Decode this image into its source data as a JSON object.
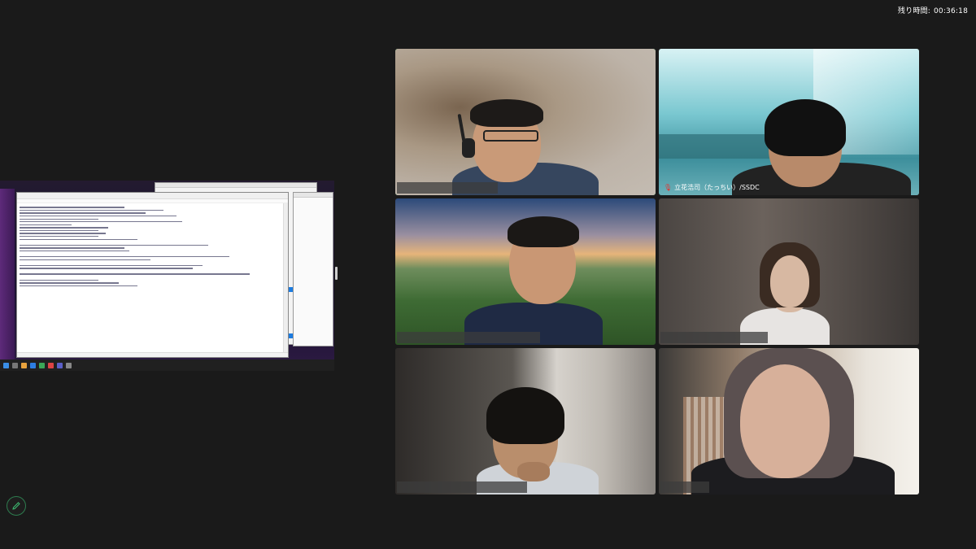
{
  "timer": {
    "label": "残り時間:",
    "value": "00:36:18"
  },
  "participants": [
    {
      "name": "",
      "active": true
    },
    {
      "name": "立花浩司（たっちい）/SSDC",
      "muted": true
    },
    {
      "name": ""
    },
    {
      "name": ""
    },
    {
      "name": ""
    },
    {
      "name": ""
    }
  ],
  "icons": {
    "edit": "pencil-icon",
    "mic": "mic-muted-icon"
  },
  "colors": {
    "active_border": "#23d959",
    "muted": "#e5322d",
    "background": "#1a1a1a"
  }
}
